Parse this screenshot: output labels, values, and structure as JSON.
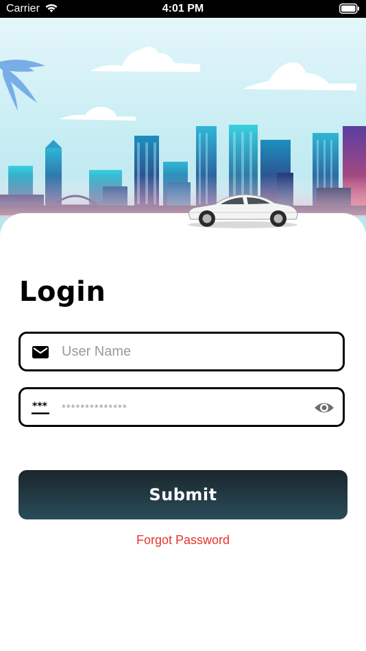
{
  "status_bar": {
    "carrier": "Carrier",
    "time": "4:01 PM",
    "wifi_icon": "wifi-icon",
    "battery_icon": "battery-icon"
  },
  "hero": {
    "illustration": "city-skyline-with-car"
  },
  "login": {
    "title": "Login",
    "username": {
      "placeholder": "User Name",
      "value": "",
      "icon": "mail-icon"
    },
    "password": {
      "placeholder": "**************",
      "value": "",
      "icon": "password-dots-icon",
      "toggle_icon": "eye-icon"
    },
    "submit_label": "Submit",
    "forgot_password_label": "Forgot Password"
  },
  "colors": {
    "status_bar": "#000000",
    "button_gradient_top": "#1a262c",
    "button_gradient_bottom": "#2a4c5a",
    "forgot_link": "#e5352b",
    "field_border": "#000000",
    "placeholder": "#9a9a9a"
  }
}
